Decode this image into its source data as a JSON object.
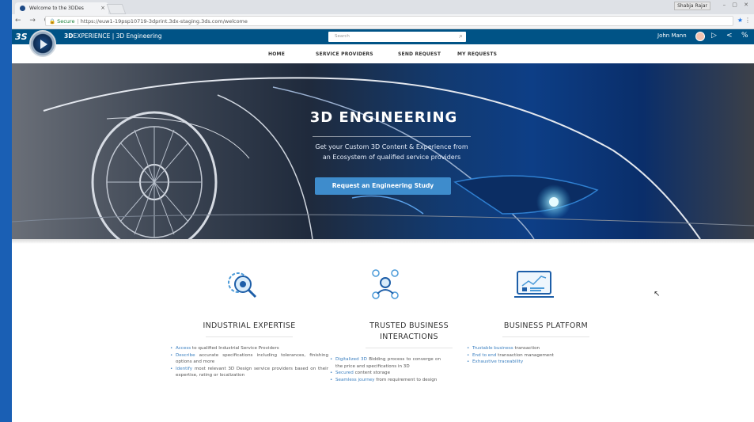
{
  "browser": {
    "tab_title": "Welcome to the 3DDes",
    "tab_close": "×",
    "window_user": "Shabja Rajar",
    "window_controls": "– ▢ ✕",
    "nav_buttons": "← → C",
    "secure_label": "Secure",
    "url": "https://euw1-19psp10719-3dprint.3dx-staging.3ds.com/welcome"
  },
  "app": {
    "brand_bold": "3D",
    "brand_rest": "EXPERIENCE | 3D Engineering",
    "search_placeholder": "Search",
    "user_name": "John Mann"
  },
  "nav": {
    "items": [
      "HOME",
      "SERVICE PROVIDERS",
      "SEND REQUEST",
      "MY REQUESTS"
    ]
  },
  "hero": {
    "title": "3D ENGINEERING",
    "subtitle_line1": "Get your Custom 3D Content & Experience from",
    "subtitle_line2": "an Ecosystem of qualified service providers",
    "button": "Request an Engineering Study"
  },
  "features": [
    {
      "title_line1": "INDUSTRIAL EXPERTISE",
      "title_line2": "",
      "items": [
        {
          "hl": "Access",
          "text": " to qualified Industrial Service Providers"
        },
        {
          "hl": "Describe",
          "text": " accurate specifications including tolerances, finishing options and more"
        },
        {
          "hl": "Identify",
          "text": " most relevant 3D Design service providers based on their expertise, rating or localization"
        }
      ]
    },
    {
      "title_line1": "TRUSTED BUSINESS",
      "title_line2": "INTERACTIONS",
      "items": [
        {
          "hl": "Digitalized 3D",
          "text": " Bidding process to converge on the price and specifications in 3D"
        },
        {
          "hl": "Secured",
          "text": " content storage"
        },
        {
          "hl": "Seamless journey",
          "text": " from requirement to design"
        }
      ]
    },
    {
      "title_line1": "BUSINESS PLATFORM",
      "title_line2": "",
      "items": [
        {
          "hl": "Trustable business",
          "text": " transaction"
        },
        {
          "hl": "End to end",
          "text": " transaction management"
        },
        {
          "hl": "Exhaustive traceability",
          "text": ""
        }
      ]
    }
  ],
  "colors": {
    "header_bg": "#005386",
    "accent": "#3e8ccc",
    "highlight_text": "#3a7fc0"
  },
  "icons": [
    "gear-magnifier-icon",
    "people-network-icon",
    "dashboard-chart-icon",
    "share-icon",
    "compass-icon"
  ]
}
